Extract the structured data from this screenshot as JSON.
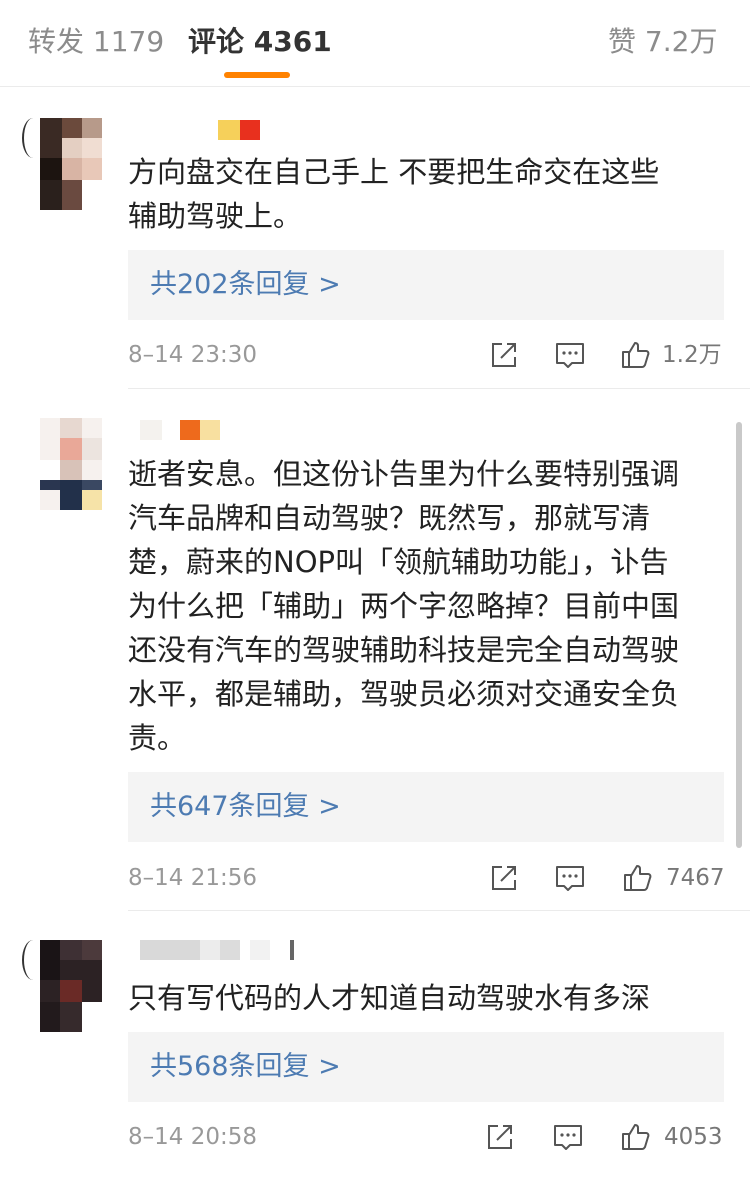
{
  "tabs": {
    "repost": {
      "label": "转发",
      "count": "1179"
    },
    "comments": {
      "label": "评论",
      "count": "4361"
    },
    "likes": {
      "label": "赞",
      "count": "7.2万"
    }
  },
  "colors": {
    "accent": "#ff8200",
    "link": "#4d7bb2",
    "meta": "#999999"
  },
  "icons": {
    "share": "share-icon",
    "comment": "comment-icon",
    "like": "thumbs-up-icon"
  },
  "comments": [
    {
      "text": "方向盘交在自己手上  不要把生命交在这些\n辅助驾驶上。",
      "replies": "共202条回复 >",
      "time": "8–14 23:30",
      "likes": "1.2万"
    },
    {
      "text": "逝者安息。但这份讣告里为什么要特别强调\n汽车品牌和自动驾驶？既然写，那就写清\n楚，蔚来的NOP叫「领航辅助功能」，讣告\n为什么把「辅助」两个字忽略掉？目前中国\n还没有汽车的驾驶辅助科技是完全自动驾驶\n水平，都是辅助，驾驶员必须对交通安全负\n责。",
      "replies": "共647条回复 >",
      "time": "8–14 21:56",
      "likes": "7467"
    },
    {
      "text": "只有写代码的人才知道自动驾驶水有多深",
      "replies": "共568条回复 >",
      "time": "8–14 20:58",
      "likes": "4053"
    }
  ]
}
